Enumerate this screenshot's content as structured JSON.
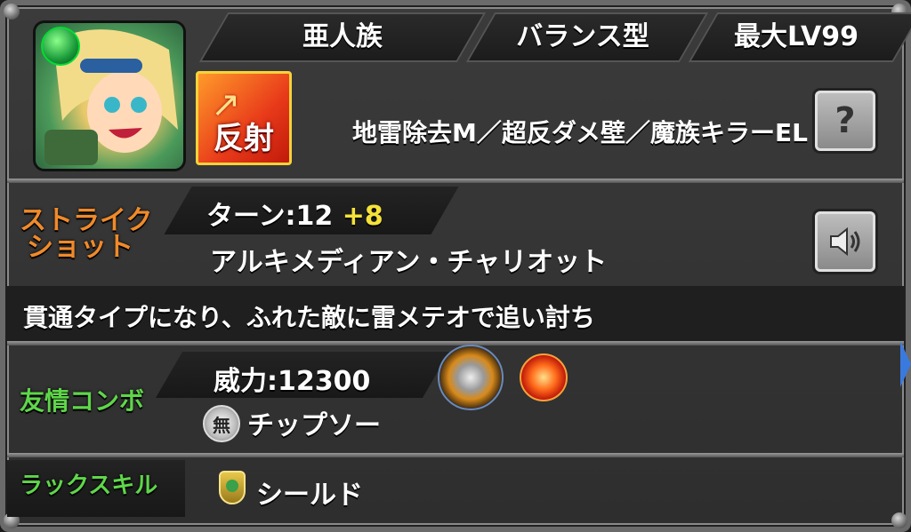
{
  "header": {
    "race": "亜人族",
    "type": "バランス型",
    "max_level": "最大LV99"
  },
  "character": {
    "badge_label": "反射",
    "abilities": "地雷除去M／超反ダメ壁／魔族キラーEL"
  },
  "strike_shot": {
    "label_line1": "ストライク",
    "label_line2": "ショット",
    "turn_text": "ターン:12",
    "turn_bonus": "+8",
    "name": "アルキメディアン・チャリオット",
    "description": "貫通タイプになり、ふれた敵に雷メテオで追い討ち"
  },
  "friendship_combo": {
    "label": "友情コンボ",
    "power_text": "威力:12300",
    "element_badge": "無",
    "name": "チップソー"
  },
  "luck_skill": {
    "label": "ラックスキル",
    "name": "シールド"
  },
  "icons": {
    "help": "question-mark-icon",
    "voice": "speaker-icon"
  },
  "colors": {
    "strike_label": "#f08a2a",
    "friend_label": "#5fd64a",
    "luck_label": "#5fd64a",
    "bonus": "#f5e23a"
  }
}
